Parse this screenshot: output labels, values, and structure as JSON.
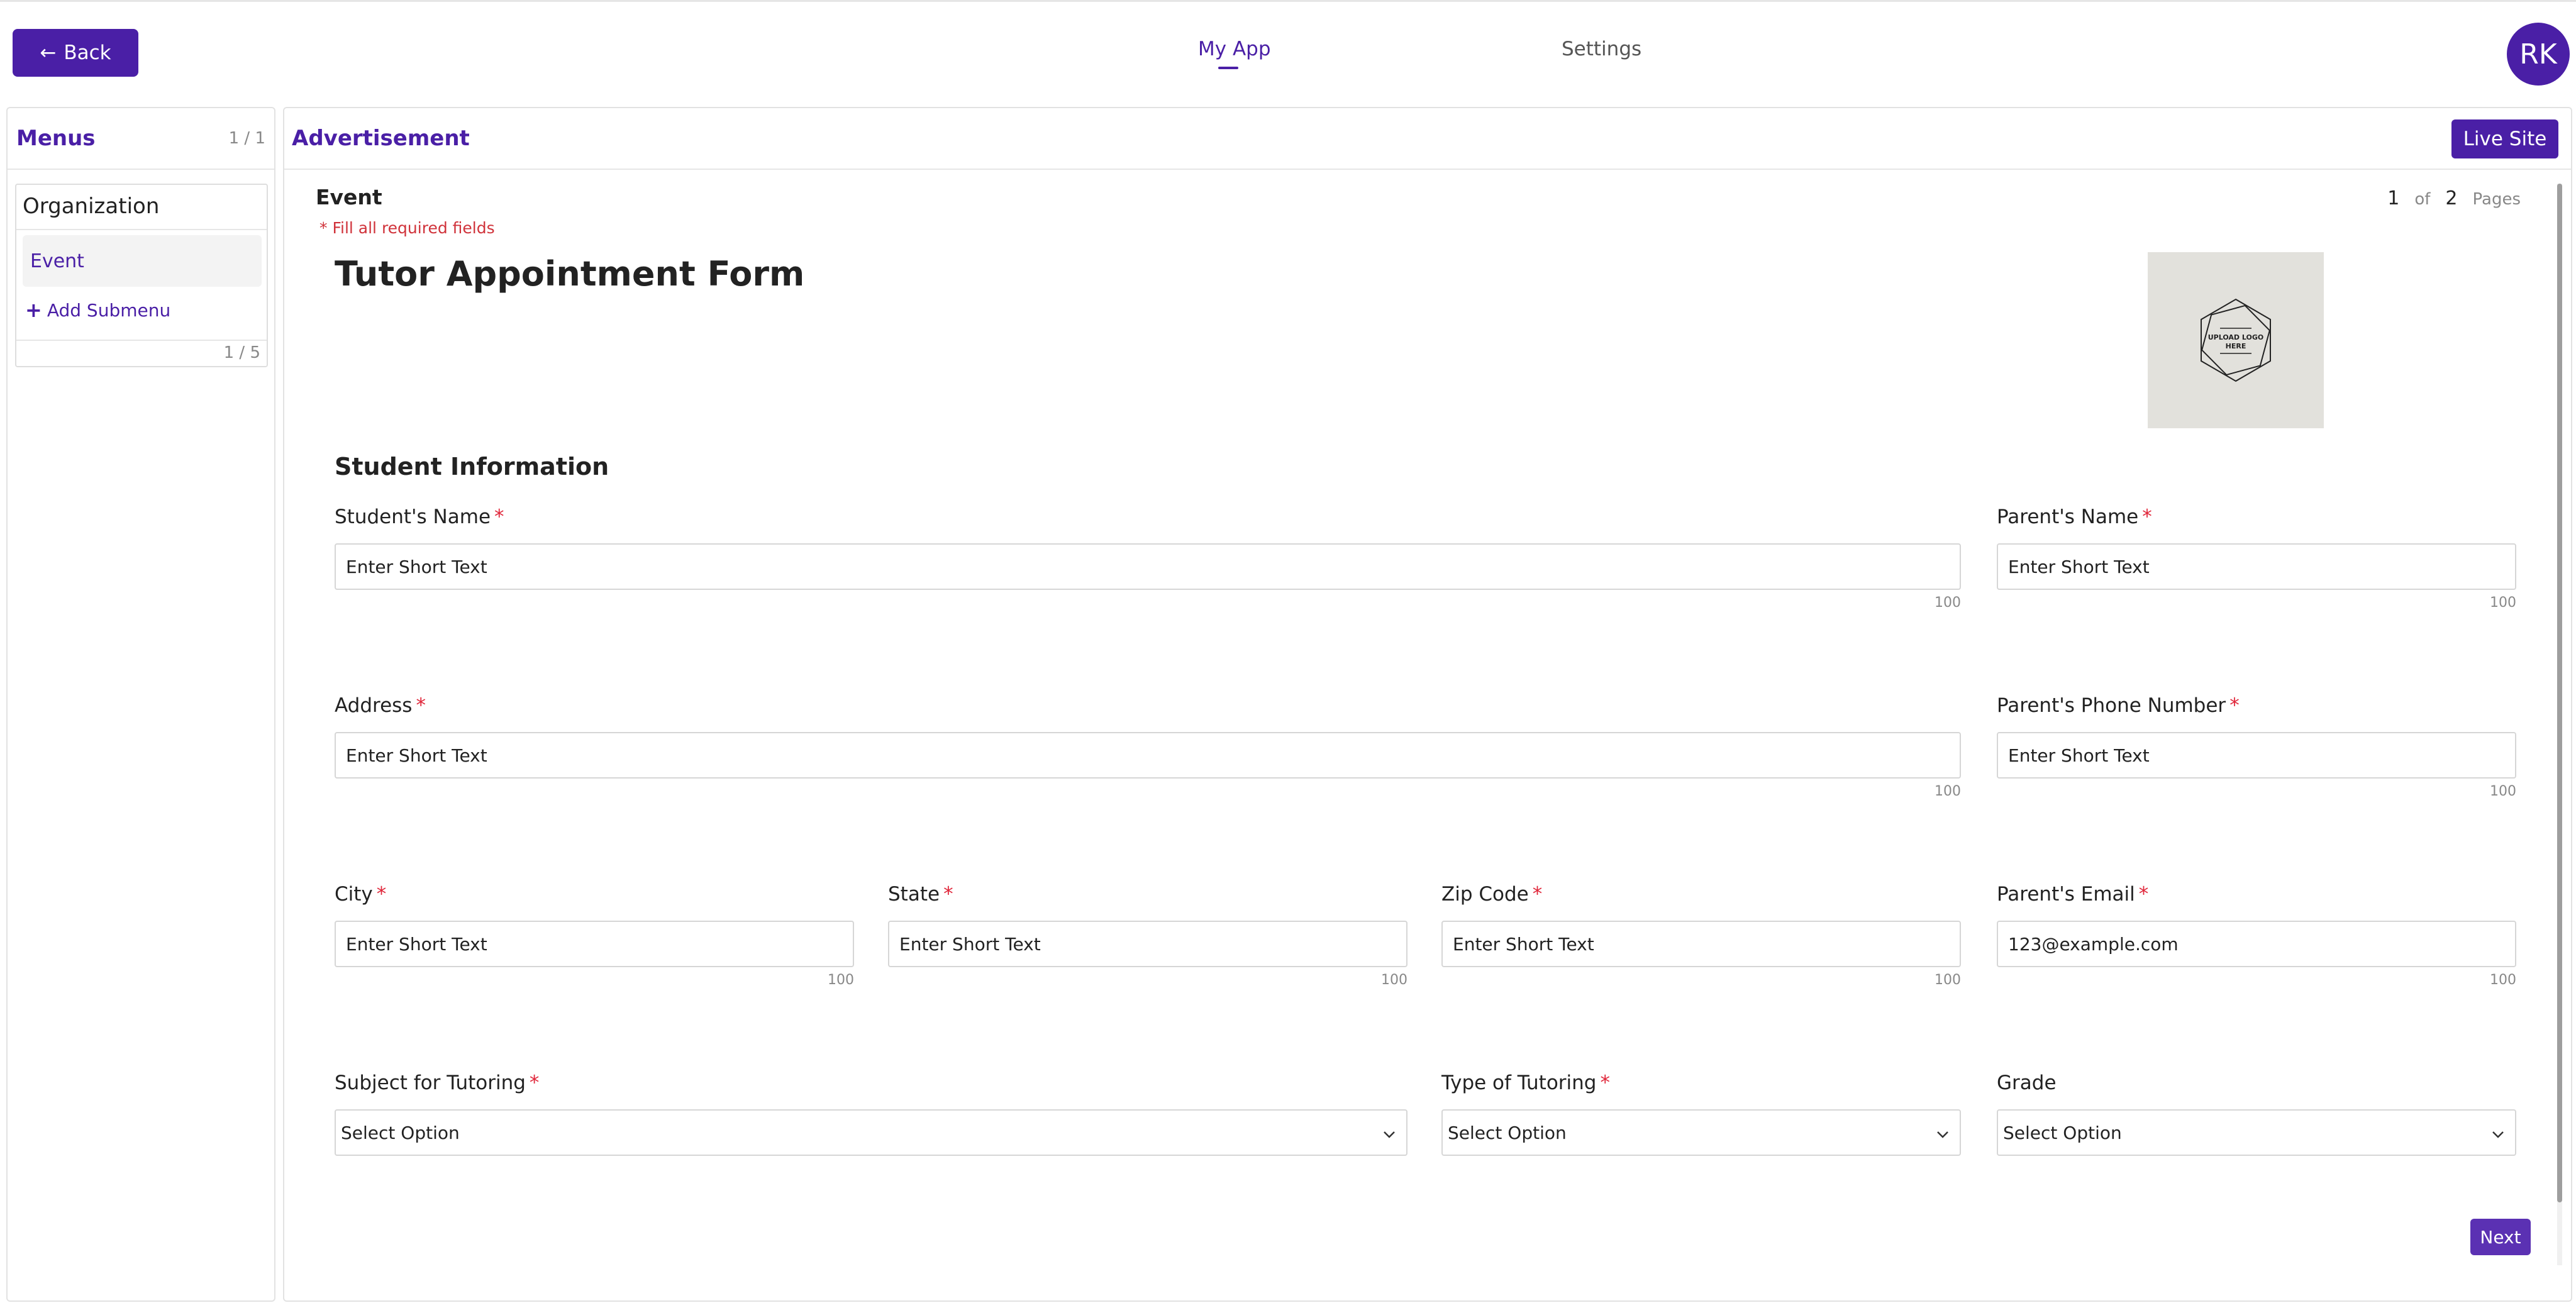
{
  "header": {
    "back_label": "Back",
    "tabs": [
      {
        "label": "My App",
        "active": true
      },
      {
        "label": "Settings",
        "active": false
      }
    ],
    "avatar_initials": "RK"
  },
  "sidebar": {
    "title": "Menus",
    "count": "1 / 1",
    "organization": {
      "title": "Organization",
      "items": [
        {
          "label": "Event",
          "active": true
        }
      ],
      "add_label": "Add Submenu",
      "count": "1 / 5"
    }
  },
  "main": {
    "title": "Advertisement",
    "live_site_label": "Live Site",
    "event_label": "Event",
    "required_note": "* Fill all required fields",
    "pager": {
      "current": "1",
      "of": "of",
      "total": "2",
      "pages": "Pages"
    },
    "form_title": "Tutor Appointment Form",
    "logo_text_line1": "UPLOAD LOGO",
    "logo_text_line2": "HERE",
    "section_title": "Student Information",
    "fields": {
      "student_name": {
        "label": "Student's Name",
        "required": "*",
        "placeholder": "Enter Short Text",
        "max": "100"
      },
      "parent_name": {
        "label": "Parent's Name",
        "required": "*",
        "placeholder": "Enter Short Text",
        "max": "100"
      },
      "address": {
        "label": "Address",
        "required": "*",
        "placeholder": "Enter Short Text",
        "max": "100"
      },
      "parent_phone": {
        "label": "Parent's Phone Number",
        "required": "*",
        "placeholder": "Enter Short Text",
        "max": "100"
      },
      "city": {
        "label": "City",
        "required": "*",
        "placeholder": "Enter Short Text",
        "max": "100"
      },
      "state": {
        "label": "State",
        "required": "*",
        "placeholder": "Enter Short Text",
        "max": "100"
      },
      "zip": {
        "label": "Zip Code",
        "required": "*",
        "placeholder": "Enter Short Text",
        "max": "100"
      },
      "parent_email": {
        "label": "Parent's Email",
        "required": "*",
        "placeholder": "123@example.com",
        "max": "100"
      },
      "subject": {
        "label": "Subject for Tutoring",
        "required": "*",
        "value": "Select Option"
      },
      "tutoring_type": {
        "label": "Type of Tutoring",
        "required": "*",
        "value": "Select Option"
      },
      "grade": {
        "label": "Grade",
        "value": "Select Option"
      }
    },
    "next_label": "Next"
  },
  "colors": {
    "accent": "#4a1fa6",
    "required": "#e0263a"
  }
}
